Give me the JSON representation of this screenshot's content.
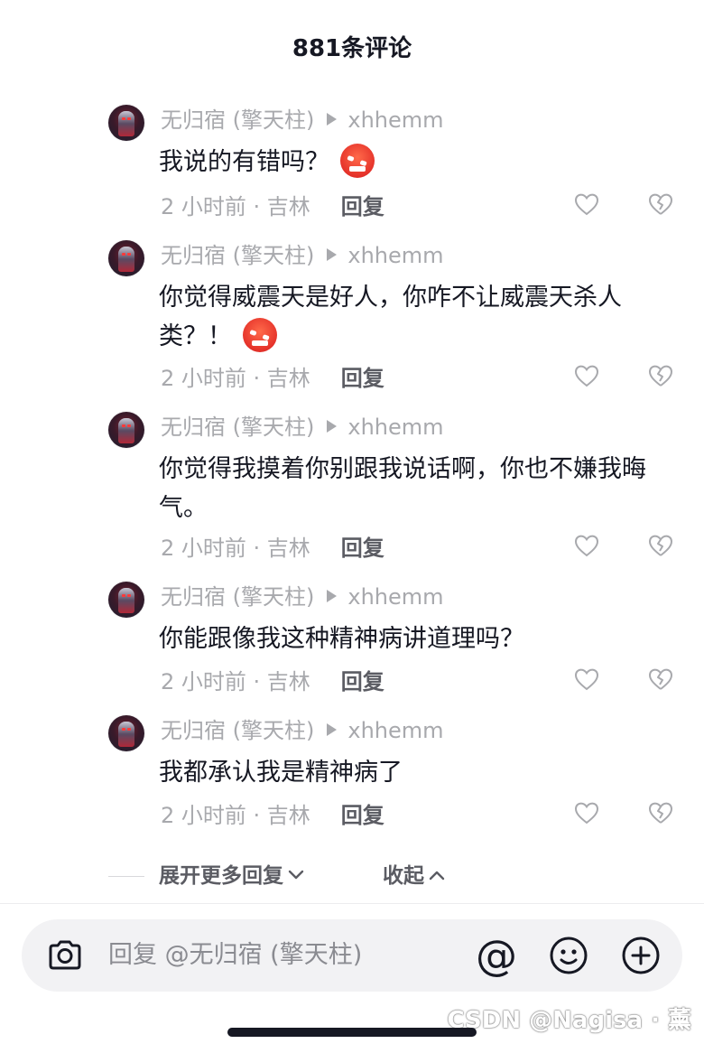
{
  "header": {
    "title": "881条评论"
  },
  "replies": [
    {
      "user": "无归宿 (擎天柱)",
      "reply_to": "xhhemm",
      "text": "我说的有错吗？",
      "emoji": "angry-face",
      "time": "2 小时前 · 吉林",
      "reply_label": "回复"
    },
    {
      "user": "无归宿 (擎天柱)",
      "reply_to": "xhhemm",
      "text": "你觉得威震天是好人，你咋不让威震天杀人类？！",
      "emoji": "angry-face",
      "time": "2 小时前 · 吉林",
      "reply_label": "回复"
    },
    {
      "user": "无归宿 (擎天柱)",
      "reply_to": "xhhemm",
      "text": "你觉得我摸着你别跟我说话啊，你也不嫌我晦气。",
      "time": "2 小时前 · 吉林",
      "reply_label": "回复"
    },
    {
      "user": "无归宿 (擎天柱)",
      "reply_to": "xhhemm",
      "text": "你能跟像我这种精神病讲道理吗？",
      "time": "2 小时前 · 吉林",
      "reply_label": "回复"
    },
    {
      "user": "无归宿 (擎天柱)",
      "reply_to": "xhhemm",
      "text": "我都承认我是精神病了",
      "time": "2 小时前 · 吉林",
      "reply_label": "回复"
    }
  ],
  "thread_actions": {
    "expand_more": "展开更多回复",
    "collapse": "收起"
  },
  "input_bar": {
    "placeholder": "回复 @无归宿 (擎天柱)",
    "icons": [
      "camera-icon",
      "at-icon",
      "emoji-icon",
      "plus-icon"
    ]
  },
  "watermark": "CSDN @Nagisa · 薰",
  "colors": {
    "text_primary": "#161823",
    "text_secondary": "#a8a9ad",
    "input_bg": "#f2f2f4",
    "emoji_red": "#e5322a"
  }
}
